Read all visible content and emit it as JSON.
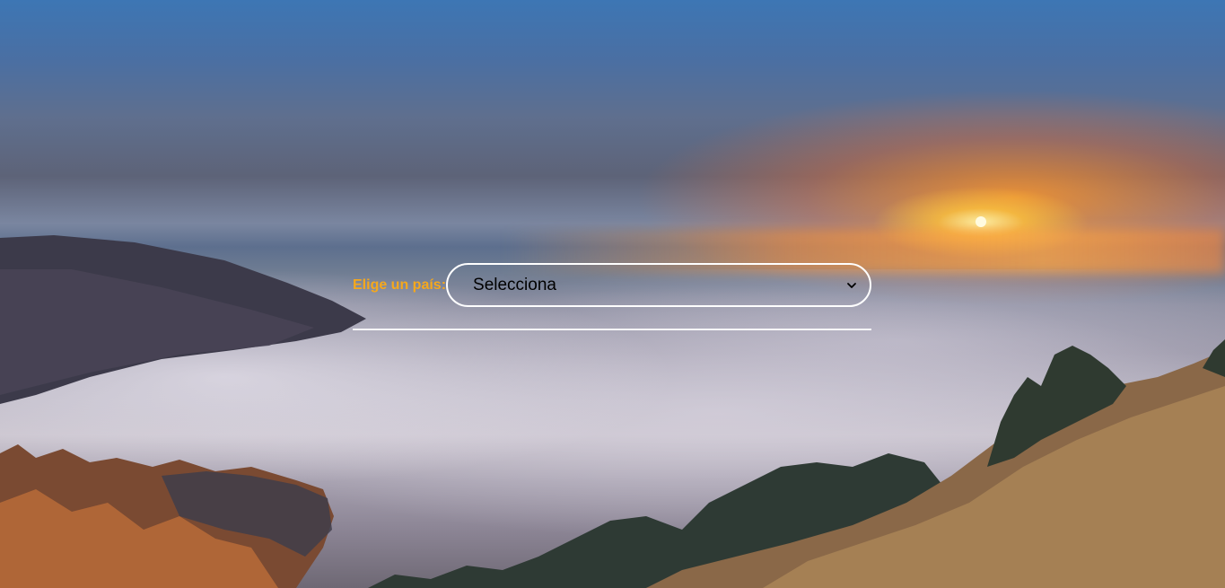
{
  "form": {
    "country_label": "Elige un país:",
    "country_select": {
      "selected": "Selecciona",
      "icon": "chevron-down-icon"
    }
  },
  "colors": {
    "label": "#f5a81c",
    "select_border": "#ffffff",
    "select_text": "#000000",
    "divider": "#ffffff"
  }
}
